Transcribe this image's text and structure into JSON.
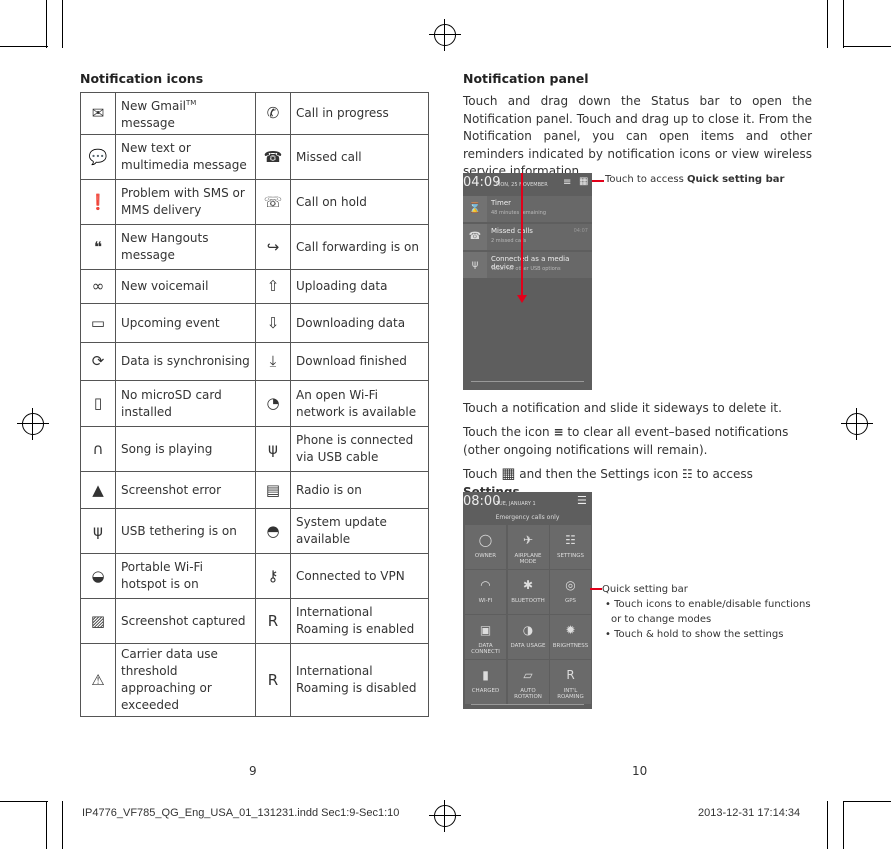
{
  "left": {
    "title": "Notification icons",
    "page_number": "9",
    "rows": [
      {
        "icon1": "gmail-icon",
        "label1": "New Gmail",
        "sup": "TM",
        "label1_suffix": " message",
        "icon2": "call-icon",
        "label2": "Call in progress"
      },
      {
        "icon1": "sms-icon",
        "label1": "New text or multimedia message",
        "icon2": "missed-call-icon",
        "label2": "Missed call"
      },
      {
        "icon1": "sms-problem-icon",
        "label1": "Problem with SMS or MMS delivery",
        "icon2": "call-hold-icon",
        "label2": "Call on hold"
      },
      {
        "icon1": "hangouts-icon",
        "label1": "New Hangouts message",
        "icon2": "call-forward-icon",
        "label2": "Call forwarding is on"
      },
      {
        "icon1": "voicemail-icon",
        "label1": "New voicemail",
        "icon2": "upload-icon",
        "label2": "Uploading data"
      },
      {
        "icon1": "calendar-icon",
        "label1": "Upcoming event",
        "icon2": "download-icon",
        "label2": "Downloading data"
      },
      {
        "icon1": "sync-icon",
        "label1": "Data is synchronising",
        "icon2": "download-done-icon",
        "label2": "Download finished"
      },
      {
        "icon1": "no-sd-icon",
        "label1": "No microSD card installed",
        "icon2": "wifi-open-icon",
        "label2": "An open Wi-Fi network is available"
      },
      {
        "icon1": "headphones-icon",
        "label1": "Song is playing",
        "icon2": "usb-icon",
        "label2": "Phone is connected via USB cable"
      },
      {
        "icon1": "screenshot-error-icon",
        "label1": "Screenshot error",
        "icon2": "radio-icon",
        "label2": "Radio is on"
      },
      {
        "icon1": "usb-tether-icon",
        "label1": "USB tethering is on",
        "icon2": "android-icon",
        "label2": "System update available"
      },
      {
        "icon1": "hotspot-icon",
        "label1": "Portable Wi-Fi hotspot is on",
        "icon2": "vpn-key-icon",
        "label2": "Connected to VPN"
      },
      {
        "icon1": "screenshot-icon",
        "label1": "Screenshot captured",
        "icon2": "roaming-icon",
        "label2": "International Roaming is enabled"
      },
      {
        "icon1": "warning-icon",
        "label1": "Carrier data use threshold approaching or exceeded",
        "icon2": "roaming-off-icon",
        "label2": "International Roaming is disabled"
      }
    ]
  },
  "right": {
    "title": "Notification panel",
    "page_number": "10",
    "intro": "Touch and drag down the Status bar to open the Notification panel. Touch and drag up to close it. From the Notification panel, you can open items and other reminders indicated by notification icons or view wireless service information.",
    "callout1_prefix": "Touch to access ",
    "callout1_bold": "Quick setting bar",
    "para2": "Touch a notification and slide it sideways to delete it.",
    "para3_a": "Touch the icon ",
    "para3_b": " to clear all event–based notifications (other ongoing notifications will remain).",
    "para4_a": "Touch ",
    "para4_b": " and then the Settings icon ",
    "para4_c": " to access ",
    "para4_bold": "Settings",
    "para4_end": ".",
    "callout2_title": "Quick setting bar",
    "callout2_bullets": [
      "Touch icons to enable/disable functions or to change modes",
      "Touch & hold to show the settings"
    ],
    "screen1": {
      "time": "04:09",
      "date": "MON, 25 NOVEMBER",
      "notifications": [
        {
          "title": "Timer",
          "sub": "48 minutes remaining",
          "icon": "hourglass-icon"
        },
        {
          "title": "Missed calls",
          "sub": "2 missed calls",
          "time": "04:07",
          "icon": "missed-call-icon"
        },
        {
          "title": "Connected as a media device",
          "sub": "Touch for other USB options",
          "icon": "usb-icon"
        }
      ]
    },
    "screen2": {
      "time": "08:00",
      "date": "TUE, JANUARY 1",
      "status": "Emergency calls only",
      "tiles": [
        "OWNER",
        "AIRPLANE MODE",
        "SETTINGS",
        "WI-FI",
        "BLUETOOTH",
        "GPS",
        "DATA CONNECTI",
        "DATA USAGE",
        "BRIGHTNESS",
        "CHARGED",
        "AUTO ROTATION",
        "INT'L ROAMING"
      ]
    }
  },
  "footer": {
    "file": "IP4776_VF785_QG_Eng_USA_01_131231.indd   Sec1:9-Sec1:10",
    "datetime": "2013-12-31   17:14:34"
  },
  "colors": {
    "accent": "#e2001a",
    "phone_bg": "#5e5e5e"
  }
}
